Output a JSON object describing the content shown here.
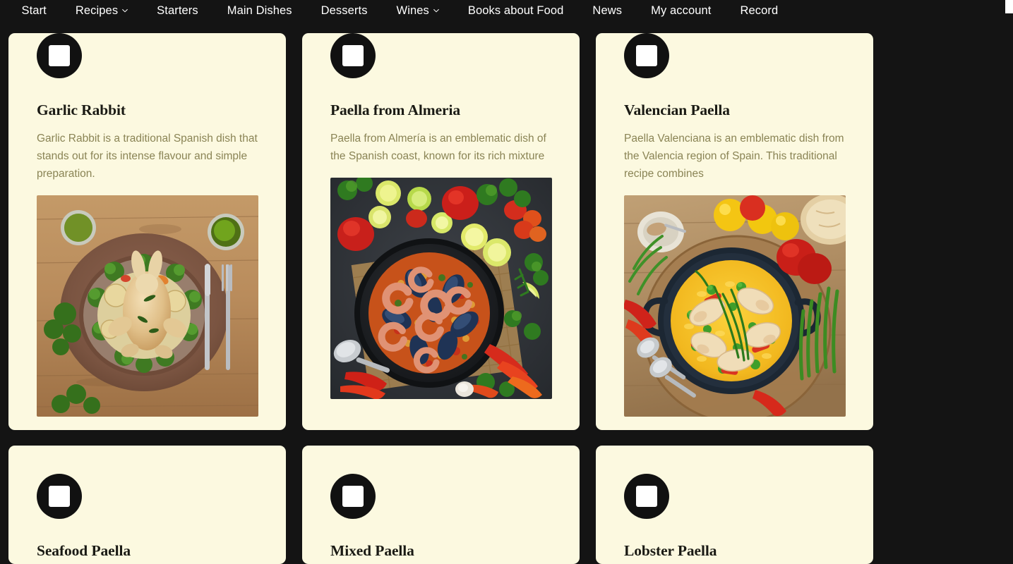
{
  "nav": {
    "items": [
      {
        "label": "Start",
        "has_dropdown": false
      },
      {
        "label": "Recipes",
        "has_dropdown": true,
        "icon": "chevron-down-icon"
      },
      {
        "label": "Starters",
        "has_dropdown": false
      },
      {
        "label": "Main Dishes",
        "has_dropdown": false
      },
      {
        "label": "Desserts",
        "has_dropdown": false
      },
      {
        "label": "Wines",
        "has_dropdown": true,
        "icon": "chevron-down-icon"
      },
      {
        "label": "Books about Food",
        "has_dropdown": false
      },
      {
        "label": "News",
        "has_dropdown": false
      },
      {
        "label": "My account",
        "has_dropdown": false
      },
      {
        "label": "Record",
        "has_dropdown": false
      }
    ]
  },
  "colors": {
    "page_background": "#141414",
    "card_background": "#FCF9E0",
    "nav_text": "#ffffff",
    "title_text": "#1a1a14",
    "body_text": "#8a8455",
    "icon_circle": "#111111",
    "icon_glyph": "#ffffff"
  },
  "cards": [
    {
      "icon": "rounded-square-icon",
      "title": "Garlic Rabbit",
      "description": "Garlic Rabbit is a traditional Spanish dish that stands out for its intense flavour and simple preparation.",
      "image_alt": "Roasted rabbit on a brown ceramic plate with parsley, two jars of green sauce, fork and knife on a wooden table"
    },
    {
      "icon": "rounded-square-icon",
      "title": "Paella from Almeria",
      "description": "Paella from Almería is an emblematic dish of the Spanish coast, known for its rich mixture",
      "image_alt": "Seafood paella pan with shrimp and mussels surrounded by lemons, limes, red peppers and chillies on a dark slate"
    },
    {
      "icon": "rounded-square-icon",
      "title": "Valencian Paella",
      "description": "Paella Valenciana is an emblematic dish from the Valencia region of Spain. This traditional recipe combines",
      "image_alt": "Valencian paella with saffron rice, chicken, peas and peppers in a black pan on wood with tomatoes and green beans"
    },
    {
      "icon": "rounded-square-icon",
      "title": "Seafood Paella",
      "description": "",
      "image_alt": ""
    },
    {
      "icon": "rounded-square-icon",
      "title": "Mixed Paella",
      "description": "",
      "image_alt": ""
    },
    {
      "icon": "rounded-square-icon",
      "title": "Lobster Paella",
      "description": "",
      "image_alt": ""
    }
  ]
}
